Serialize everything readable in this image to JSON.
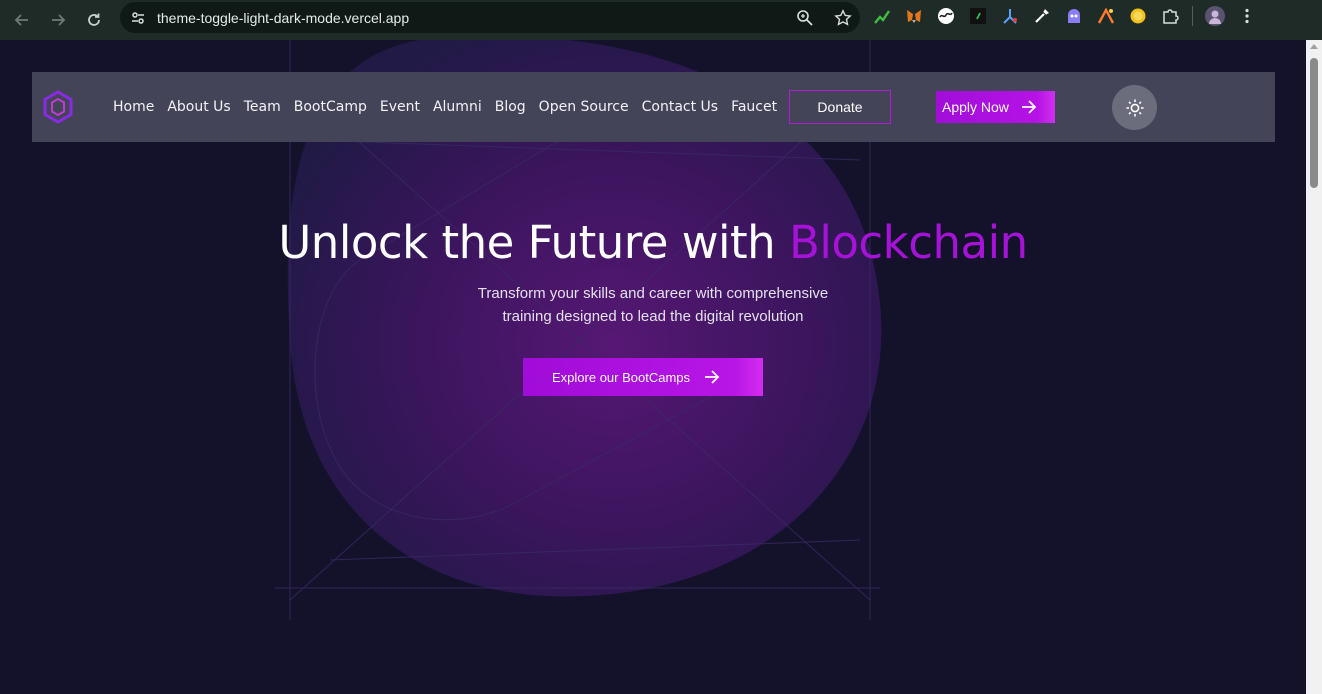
{
  "browser": {
    "url": "theme-toggle-light-dark-mode.vercel.app",
    "back_icon": "arrow-left-icon",
    "forward_icon": "arrow-right-icon",
    "reload_icon": "reload-icon",
    "site_info_icon": "tune-icon",
    "zoom_icon": "zoom-icon",
    "bookmark_icon": "star-icon",
    "extensions": [
      {
        "name": "chart-extension-icon",
        "color": "#3fbf3f"
      },
      {
        "name": "metamask-fox-icon",
        "color": "#e2761b"
      },
      {
        "name": "wave-extension-icon",
        "color": "#ffffff"
      },
      {
        "name": "terminal-extension-icon",
        "color": "#26c54f"
      },
      {
        "name": "network-extension-icon",
        "color": "#5aa0ff"
      },
      {
        "name": "eyedropper-icon",
        "color": "#ffffff"
      },
      {
        "name": "robot-extension-icon",
        "color": "#8a7cf5"
      },
      {
        "name": "spark-extension-icon",
        "color": "#ff7a30"
      },
      {
        "name": "coin-extension-icon",
        "color": "#f2c21b"
      },
      {
        "name": "puzzle-icon",
        "color": "#d8dfdc"
      }
    ],
    "profile_icon": "avatar",
    "menu_icon": "kebab-menu-icon"
  },
  "header": {
    "logo_icon": "hexagon-logo-icon",
    "nav": [
      "Home",
      "About Us",
      "Team",
      "BootCamp",
      "Event",
      "Alumni",
      "Blog",
      "Open Source",
      "Contact Us",
      "Faucet"
    ],
    "donate_label": "Donate",
    "apply_label": "Apply Now",
    "apply_icon": "arrow-right-icon",
    "theme_toggle_icon": "sun-icon"
  },
  "hero": {
    "title_prefix": "Unlock the Future with",
    "title_accent": "Blockchain",
    "subtitle_line1": "Transform your skills and career with comprehensive",
    "subtitle_line2": "training designed to lead the digital revolution",
    "cta_label": "Explore our BootCamps",
    "cta_icon": "arrow-right-icon"
  },
  "colors": {
    "background": "#13122a",
    "header": "#434458",
    "accent": "#a712d8",
    "toggle": "#6b6c7c"
  }
}
